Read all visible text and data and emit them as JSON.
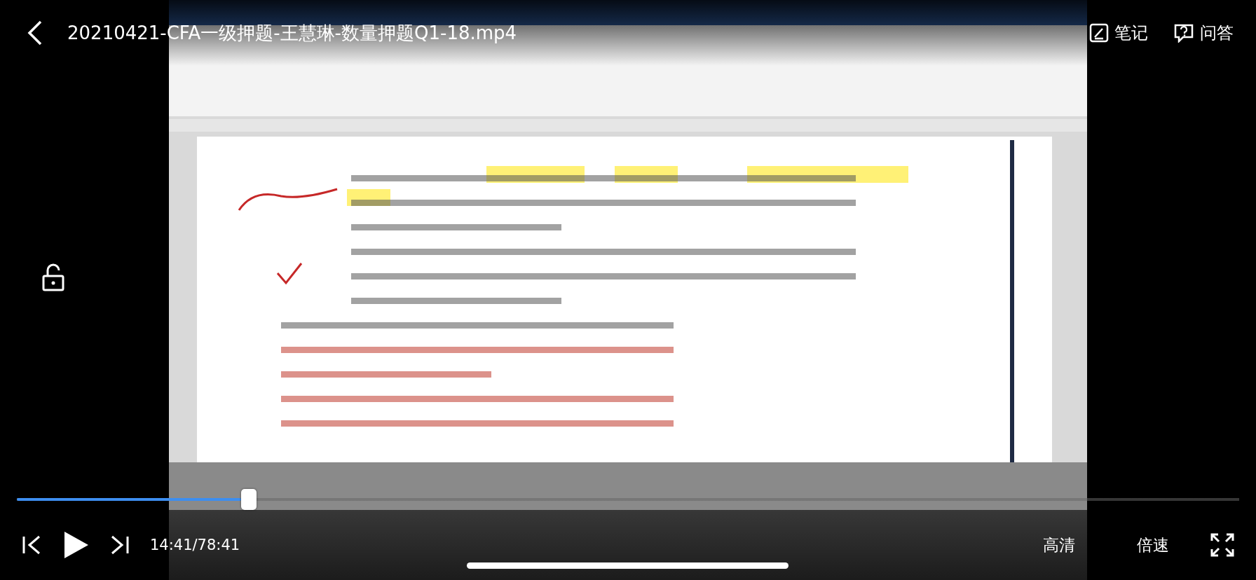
{
  "title": "20210421-CFA一级押题-王慧琳-数量押题Q1-18.mp4",
  "header_actions": [
    {
      "kind": "notes",
      "label": "笔记"
    },
    {
      "kind": "qa",
      "label": "问答"
    }
  ],
  "lock": {
    "locked": false
  },
  "player": {
    "level": 0.19,
    "playing": false,
    "time": "14:41/78:41",
    "quality": "高清",
    "speed": "倍速"
  }
}
